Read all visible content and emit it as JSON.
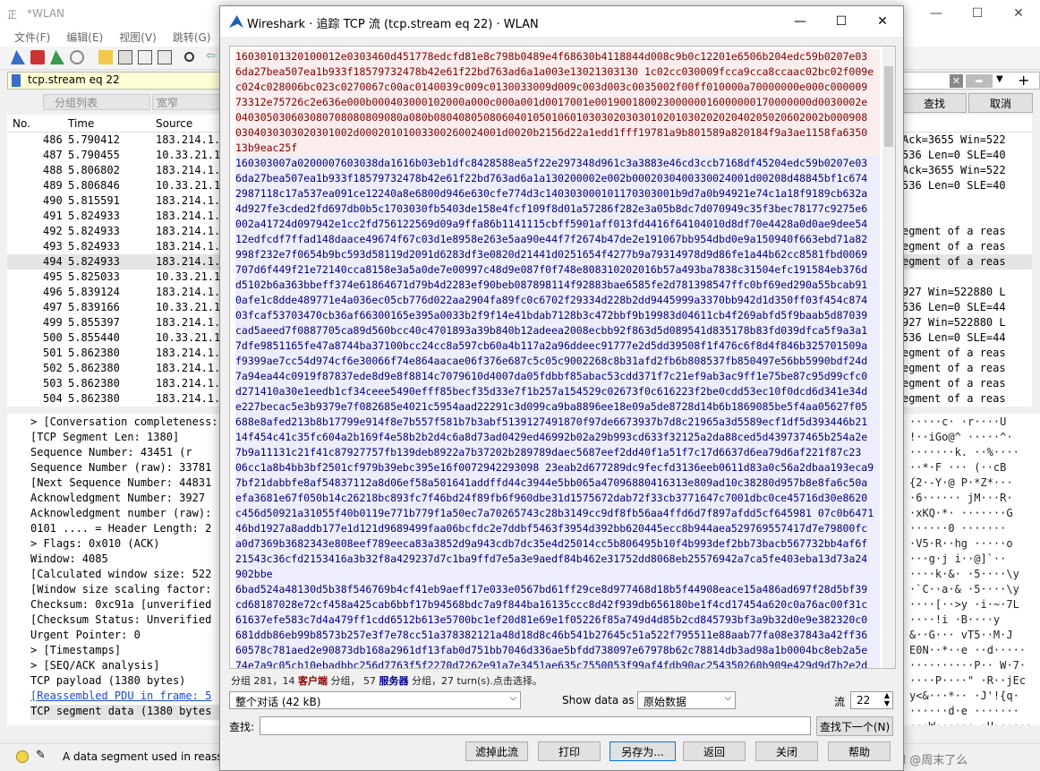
{
  "main": {
    "title": "*WLAN",
    "menu": [
      "文件(F)",
      "编辑(E)",
      "视图(V)",
      "跳转(G)",
      "捕"
    ],
    "filter": "tcp.stream eq 22",
    "toolbar_row": {
      "group_list": "分组列表",
      "narrow": "宽窄",
      "find": "查找",
      "cancel": "取消"
    },
    "columns": {
      "no": "No.",
      "time": "Time",
      "source": "Source"
    },
    "packets": [
      {
        "no": "486",
        "time": "5.790412",
        "src": "183.214.1.",
        "info": "Ack=3655 Win=522"
      },
      {
        "no": "487",
        "time": "5.790455",
        "src": "10.33.21.1",
        "info": "536 Len=0 SLE=40"
      },
      {
        "no": "488",
        "time": "5.806802",
        "src": "183.214.1.",
        "info": "Ack=3655 Win=522"
      },
      {
        "no": "489",
        "time": "5.806846",
        "src": "10.33.21.1",
        "info": "536 Len=0 SLE=40"
      },
      {
        "no": "490",
        "time": "5.815591",
        "src": "183.214.1.",
        "info": ""
      },
      {
        "no": "491",
        "time": "5.824933",
        "src": "183.214.1.",
        "info": ""
      },
      {
        "no": "492",
        "time": "5.824933",
        "src": "183.214.1.",
        "info": "egment of a reas"
      },
      {
        "no": "493",
        "time": "5.824933",
        "src": "183.214.1.",
        "info": "egment of a reas"
      },
      {
        "no": "494",
        "time": "5.824933",
        "src": "183.214.1.",
        "info": "egment of a reas"
      },
      {
        "no": "495",
        "time": "5.825033",
        "src": "10.33.21.1",
        "info": ""
      },
      {
        "no": "496",
        "time": "5.839124",
        "src": "183.214.1.",
        "info": "927 Win=522880 L"
      },
      {
        "no": "497",
        "time": "5.839166",
        "src": "10.33.21.1",
        "info": "536 Len=0 SLE=44"
      },
      {
        "no": "499",
        "time": "5.855397",
        "src": "183.214.1.",
        "info": "927 Win=522880 L"
      },
      {
        "no": "500",
        "time": "5.855440",
        "src": "10.33.21.1",
        "info": "536 Len=0 SLE=44"
      },
      {
        "no": "501",
        "time": "5.862380",
        "src": "183.214.1.",
        "info": "egment of a reas"
      },
      {
        "no": "502",
        "time": "5.862380",
        "src": "183.214.1.",
        "info": "egment of a reas"
      },
      {
        "no": "503",
        "time": "5.862380",
        "src": "183.214.1.",
        "info": "egment of a reas"
      },
      {
        "no": "504",
        "time": "5.862380",
        "src": "183.214.1.",
        "info": "egment of a reas"
      }
    ],
    "detail": [
      "> [Conversation completeness:",
      "  [TCP Segment Len: 1380]",
      "  Sequence Number: 43451   (r",
      "  Sequence Number (raw): 33781",
      "  [Next Sequence Number: 44831",
      "  Acknowledgment Number: 3927",
      "  Acknowledgment number (raw):",
      "  0101 .... = Header Length: 2",
      "> Flags: 0x010 (ACK)",
      "  Window: 4085",
      "  [Calculated window size: 522",
      "  [Window size scaling factor:",
      "  Checksum: 0xc91a [unverified",
      "  [Checksum Status: Unverified",
      "  Urgent Pointer: 0",
      "> [Timestamps]",
      "> [SEQ/ACK analysis]",
      "  TCP payload (1380 bytes)",
      "  [Reassembled PDU in frame: 5",
      "  TCP segment data (1380 bytes"
    ],
    "hex_ascii": [
      "·····c· ·r····U",
      "!··iGo@^ ·····^·",
      "·······k. ··%····",
      "··*·F ··· (··cB",
      "{2·-Y·@ P·*Z*···",
      "·6······ jM···R·",
      "·xKQ·*· ·······G",
      "······0 ·······",
      "·V5·R··hg ·····o",
      "···g·j i··@]`··",
      "····k·&· ·5····\\y",
      "·`C··a·& ·5····\\y",
      "····[··>y ·i·~·7L",
      "····!i ·B····y",
      "&··G··· vT5··M·J",
      "E0N··*··e ··d·····",
      "··········P·· W·7·",
      "····P····\" ·R··jEc",
      "y<&···*·· ·J'!{q·",
      "······d·e ·······",
      "···W······ ·U······",
      "·hZu··P· ··· C Im",
      "·!0···k·· ·&··R···",
      "······· 4N····n p"
    ],
    "status": "A data segment used in reass",
    "watermark": "CSDN @周末了么"
  },
  "dialog": {
    "title": "Wireshark · 追踪 TCP 流 (tcp.stream eq 22) · WLAN",
    "stream_lines": [
      {
        "t": "c",
        "s": "16030101320100012e0303460d451778edcfd81e8c798b0489e4f68630b4118844d008c9b0c12201e6506b204edc59b0207e03"
      },
      {
        "t": "c",
        "s": "6da27bea507ea1b933f18579732478b42e61f22bd763ad6a1a003e13021303130 1c02cc030009fcca9cca8ccaac02bc02f009e"
      },
      {
        "t": "c",
        "s": "c024c028006bc023c0270067c00ac0140039c009c0130033009d009c003d003c0035002f00ff010000a70000000e000c000009"
      },
      {
        "t": "c",
        "s": "73312e75726c2e636e000b000403000102000a000c000a001d0017001e00190018002300000016000000170000000d0030002e"
      },
      {
        "t": "c",
        "s": "040305030603080708080809080a080b080408050806040105010601030302030301020103020202040205020602002b000908"
      },
      {
        "t": "c",
        "s": "0304030303020301002d00020101003300260024001d0020b2156d22a1edd1fff19781a9b801589a820184f9a3ae1158fa6350"
      },
      {
        "t": "c",
        "s": "13b9eac25f"
      },
      {
        "t": "s",
        "s": "160303007a0200007603038da1616b03eb1dfc8428588ea5f22e297348d961c3a3883e46cd3ccb7168df45204edc59b0207e03"
      },
      {
        "t": "s",
        "s": "6da27bea507ea1b933f18579732478b42e61f22bd763ad6a1a130200002e002b0002030400330024001d00208d48845bf1c674"
      },
      {
        "t": "s",
        "s": "2987118c17a537ea091ce12240a8e6800d946e630cfe774d3c140303000101170303001b9d7a0b94921e74c1a18f9189cb632a"
      },
      {
        "t": "s",
        "s": "4d927fe3cded2fd697db0b5c1703030fb5403de158e4fcf109f8d01a57286f282e3a05b8dc7d070949c35f3bec78177c9275e6"
      },
      {
        "t": "s",
        "s": "002a41724d097942e1cc2fd756122569d09a9ffa86b1141115cbff5901aff013fd4416f64104010d8df70e4428a0d0ae9dee54"
      },
      {
        "t": "s",
        "s": "12edfcdf7ffad148daace49674f67c03d1e8958e263e5aa90e44f7f2674b47de2e191067bb954dbd0e9a150940f663ebd71a82"
      },
      {
        "t": "s",
        "s": "998f232e7f0654b9bc593d58119d2091d6283df3e0820d21441d0251654f4277b9a79314978d9d86fe1a44b62cc8581fbd0069"
      },
      {
        "t": "s",
        "s": "707d6f449f21e72140cca8158e3a5a0de7e00997c48d9e087f0f748e808310202016b57a493ba7838c31504efc191584eb376d"
      },
      {
        "t": "s",
        "s": "d5102b6a363bbeff374e61864671d79b4d2283ef90beb087898114f92883bae6585fe2d781398547ffc0bf69ed290a55bcab91"
      },
      {
        "t": "s",
        "s": "0afe1c8dde489771e4a036ec05cb776d022aa2904fa89fc0c6702f29334d228b2dd9445999a3370bb942d1d350ff03f454c874"
      },
      {
        "t": "s",
        "s": "03fcaf53703470cb36af66300165e395a0033b2f9f14e41bdab7128b3c472bbf9b19983d04611cb4f269abfd5f9baab5d87039"
      },
      {
        "t": "s",
        "s": "cad5aeed7f0887705ca89d560bcc40c4701893a39b840b12adeea2008ecbb92f863d5d089541d835178b83fd039dfca5f9a3a1"
      },
      {
        "t": "s",
        "s": "7dfe9851165fe47a8744ba37100bcc24cc8a597cb60a4b117a2a96ddeec91777e2d5dd39508f1f476c6f8d4f846b325701509a"
      },
      {
        "t": "s",
        "s": "f9399ae7cc54d974cf6e30066f74e864aacae06f376e687c5c05c9002268c8b31afd2fb6b808537fb850497e56bb5990bdf24d"
      },
      {
        "t": "s",
        "s": "7a94ea44c0919f87837ede8d9e8f8814c7079610d4007da05fdbbf85abac53cdd371f7c21ef9ab3ac9ff1e75be87c95d99cfc0"
      },
      {
        "t": "s",
        "s": "d271410a30e1eedb1cf34ceee5490efff85becf35d33e7f1b257a154529c02673f0c616223f2be0cdd53ec10f0dcd6d341e34d"
      },
      {
        "t": "s",
        "s": "e227becac5e3b9379e7f082685e4021c5954aad22291c3d099ca9ba8896ee18e09a5de8728d14b6b1869085be5f4aa05627f05"
      },
      {
        "t": "s",
        "s": "688e8afed213b8b17799e914f8e7b557f581b7b3abf5139127491870f97de6673937b7d8c21965a3d5589ecf1df5d393446b21"
      },
      {
        "t": "s",
        "s": "14f454c41c35fc604a2b169f4e58b2b2d4c6a8d73ad0429ed46992b02a29b993cd633f32125a2da88ced5d439737465b254a2e"
      },
      {
        "t": "s",
        "s": "7b9a11131c21f41c87927757fb139deb8922a7b37202b289789daec5687eef2dd40f1a51f7c17d6637d6ea79d6af221f87c23"
      },
      {
        "t": "s",
        "s": "06cc1a8b4bb3bf2501cf979b39ebc395e16f0072942293098 23eab2d677289dc9fecfd3136eeb0611d83a0c56a2dbaa193eca9"
      },
      {
        "t": "s",
        "s": "7bf21dabbfe8af54837112a8d06ef58a501641addffd44c3944e5bb065a47096880416313e809ad10c38280d957b8e8fa6c50a"
      },
      {
        "t": "s",
        "s": "efa3681e67f050b14c26218bc893fc7f46bd24f89fb6f960dbe31d1575672dab72f33cb3771647c7001dbc0ce45716d30e8620"
      },
      {
        "t": "s",
        "s": "c456d50921a31055f40b0119e771b779f1a50ec7a70265743c28b3149cc9df8fb56aa4ffd6d7f897afdd5cf645981 07c0b6471"
      },
      {
        "t": "s",
        "s": "46bd1927a8addb177e1d121d9689499faa06bcfdc2e7ddbf5463f3954d392bb620445ecc8b944aea529769557417d7e79800fc"
      },
      {
        "t": "s",
        "s": "a0d7369b3682343e808eef789eeca83a3852d9a943cdb7dc35e4d25014cc5b806495b10f4b993def2bb73bacb567732bb4af6f"
      },
      {
        "t": "s",
        "s": "21543c36cfd2153416a3b32f8a429237d7c1ba9ffd7e5a3e9aedf84b462e31752dd8068eb25576942a7ca5fe403eba13d73a24"
      },
      {
        "t": "s",
        "s": "902bbe"
      },
      {
        "t": "s",
        "s": "6bad524a48130d5b38f546769b4cf41eb9aeff17e033e0567bd61ff29ce8d977468d18b5f44908eace15a486ad697f28d5bf39"
      },
      {
        "t": "s",
        "s": "cd68187028e72cf458a425cab6bbf17b94568bdc7a9f844ba16135ccc8d42f939db656180be1f4cd17454a620c0a76ac00f31c"
      },
      {
        "t": "s",
        "s": "61637efe583c7d4a479ff1cdd6512b613e5700bc1ef20d81e69e1f05226f85a749d4d85b2cd845793bf3a9b32d0e9e382320c0"
      },
      {
        "t": "s",
        "s": "681ddb86eb99b8573b257e3f7e78cc51a378382121a48d18d8c46b541b27645c51a522f795511e88aab77fa08e37843a42ff36"
      },
      {
        "t": "s",
        "s": "60578c781aed2e90873db168a2961df13fab0d751bb7046d336ae5bfdd738097e67978b62c78814db3ad98a1b0004bc8eb2a5e"
      },
      {
        "t": "s",
        "s": "74e7a9c05cb10ebadbbc256d7763f5f2270d7262e91a7e3451ae635c7550053f99af4fdb90ac254350260b909e429d9d7b2e2d"
      },
      {
        "t": "s",
        "s": "01c0ae5b4cc1caa527e370f97504cb593ca01742f566f769fe97eac6152032801093ea7aefac66d82c7fad357ea6b95a649416"
      },
      {
        "t": "s",
        "s": "1be192a57702a7e71f23fea42e5c624a8b16cbd87b32f40d3fe020b3c79d24c36cfd6dcf6c5cee7be27ae6e9577d54790c22ee"
      },
      {
        "t": "s",
        "s": "2891566d45c44ae2a7de8082df53673d80a8b33f8e066cee24e61f23cb0c158de570ef2fa48c72462fc45f511344064d081c3e"
      },
      {
        "t": "s",
        "s": "507b3f5d6e39ea18d540e0b91c55957178f99246ccc2129e76f37752dece45c7f870afd1654f04067e145b634d0d2238722af3"
      },
      {
        "t": "s",
        "s": "eb6242a803d11c42a1ed3e08120fc35b376677614a4455da6531424ae06a68d43a6d30a149e1b922e9ca0f24cf77510a7ed4a2"
      }
    ],
    "info": {
      "prefix": "分组 281，",
      "client_count": "14",
      "client_word": "客户端",
      "mid": "分组，",
      "server_count": "57",
      "server_word": "服务器",
      "suffix": "分组，27 turn(s).点击选择。"
    },
    "conversation_select": "整个对话 (42 kB)",
    "show_data_as_label": "Show data as",
    "show_data_as_value": "原始数据",
    "stream_label": "流",
    "stream_value": "22",
    "find_label": "查找:",
    "find_placeholder": "",
    "find_next": "查找下一个(N)",
    "buttons": {
      "filter_out": "滤掉此流",
      "print": "打印",
      "save_as": "另存为...",
      "back": "返回",
      "close": "关闭",
      "help": "帮助"
    }
  }
}
